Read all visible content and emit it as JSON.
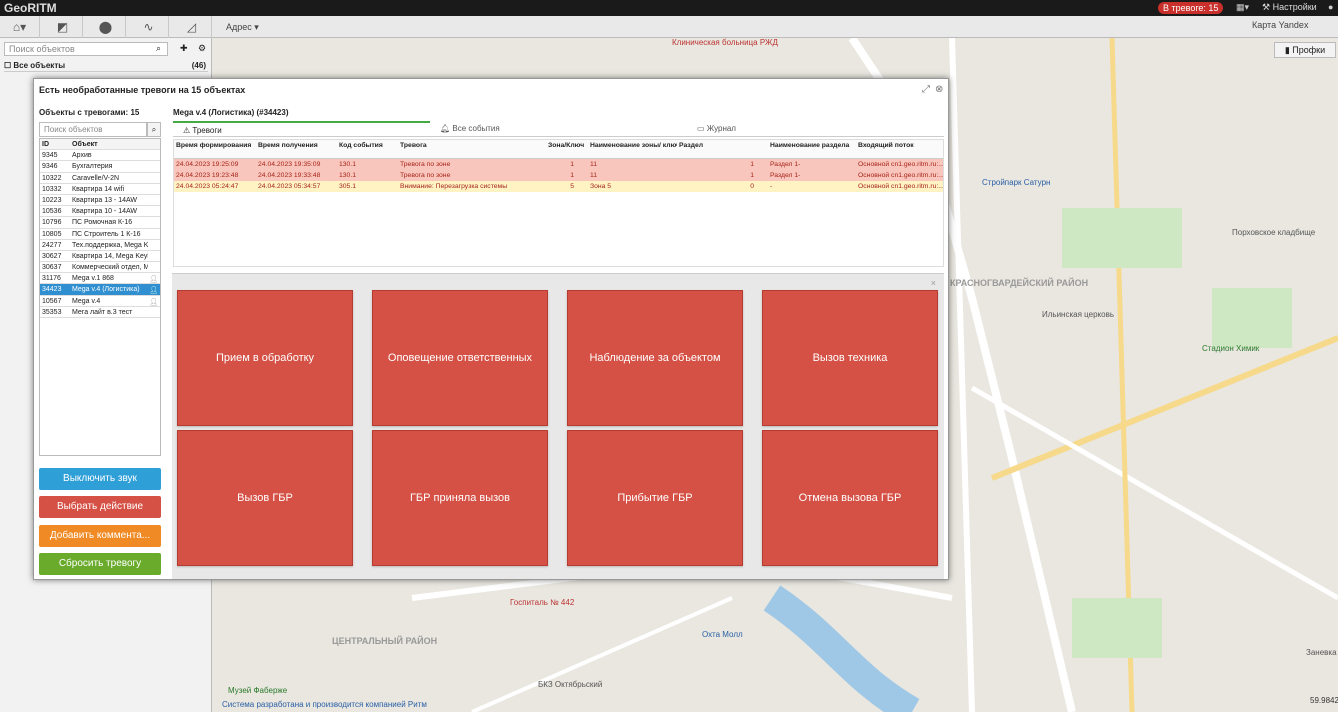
{
  "app": {
    "title": "GeoRITM",
    "alarms_badge": "В тревоге: 15",
    "settings_label": "Настройки"
  },
  "toolbar": {
    "address_label": "Адрес",
    "map_label": "Карта Yandex",
    "profiles_label": "Профки"
  },
  "left_panel": {
    "search_placeholder": "Поиск объектов",
    "all_objects_label": "Все объекты",
    "all_objects_count": "(46)"
  },
  "modal": {
    "title": "Есть необработанные тревоги на 15 объектах",
    "objects_with_alarms": "Объекты с тревогами: 15",
    "selected_object": "Mega v.4 (Логистика) (#34423)",
    "object_search_placeholder": "Поиск объектов",
    "object_columns": {
      "id": "ID",
      "name": "Объект"
    },
    "objects": [
      {
        "id": "9345",
        "name": "Архив"
      },
      {
        "id": "9346",
        "name": "Бухгалтерия"
      },
      {
        "id": "10322",
        "name": "Caravelle/V-2N"
      },
      {
        "id": "10332",
        "name": "Квартира 14 wifi"
      },
      {
        "id": "10223",
        "name": "Квартира 13 - 14AW"
      },
      {
        "id": "10536",
        "name": "Квартира 10 - 14AW"
      },
      {
        "id": "10796",
        "name": "ПС Ромочная К-16"
      },
      {
        "id": "10805",
        "name": "ПС Строитель 1 К-16"
      },
      {
        "id": "24277",
        "name": "Тех.поддержка, Mega Keyb..."
      },
      {
        "id": "30627",
        "name": "Квартира 14, Mega Keybo..."
      },
      {
        "id": "30637",
        "name": "Коммерческий отдел, Meg..."
      },
      {
        "id": "31176",
        "name": "Mega v.1 868"
      },
      {
        "id": "34423",
        "name": "Mega v.4 (Логистика)"
      },
      {
        "id": "10567",
        "name": "Mega v.4"
      },
      {
        "id": "35353",
        "name": "Мега лайт в.3 тест"
      }
    ],
    "buttons": {
      "mute": "Выключить звук",
      "choose_action": "Выбрать действие",
      "add_comment": "Добавить коммента...",
      "reset_alarm": "Сбросить тревогу"
    },
    "tabs": {
      "alarms": "Тревоги",
      "all_events": "Все события",
      "journal": "Журнал"
    },
    "columns": [
      "Время формирования",
      "Время получения",
      "Код события",
      "Тревога",
      "Зона/Ключ",
      "Наименование зоны/ ключа",
      "Раздел",
      "Наименование раздела",
      "Входящий поток"
    ],
    "rows": [
      {
        "formed": "24.04.2023 19:25:09",
        "received": "24.04.2023 19:35:09",
        "code": "130.1",
        "alarm": "Тревога по зоне",
        "zone": "1",
        "zone_name": "11",
        "section": "1",
        "section_name": "Раздел 1-",
        "stream": "Основной cn1.geo.ritm.ru:..."
      },
      {
        "formed": "24.04.2023 19:23:48",
        "received": "24.04.2023 19:33:48",
        "code": "130.1",
        "alarm": "Тревога по зоне",
        "zone": "1",
        "zone_name": "11",
        "section": "1",
        "section_name": "Раздел 1-",
        "stream": "Основной cn1.geo.ritm.ru:..."
      },
      {
        "formed": "24.04.2023 05:24:47",
        "received": "24.04.2023 05:34:57",
        "code": "305.1",
        "alarm": "Внимание: Перезагрузка системы",
        "zone": "5",
        "zone_name": "Зона 5",
        "section": "0",
        "section_name": "-",
        "stream": "Основной cn1.geo.ritm.ru:..."
      }
    ],
    "actions": [
      "Прием в обработку",
      "Оповещение ответственных",
      "Наблюдение за объектом",
      "Вызов техника",
      "Вызов ГБР",
      "ГБР приняла вызов",
      "Прибытие ГБР",
      "Отмена вызова ГБР"
    ]
  },
  "map": {
    "labels": [
      "Клиническая больница РЖД",
      "Стройпарк Сатурн",
      "Порховское кладбище",
      "КРАСНОГВАРДЕЙСКИЙ РАЙОН",
      "Ильинская церковь",
      "Стадион Химик",
      "ЦЕНТРАЛЬНЫЙ РАЙОН",
      "Госпиталь № 442",
      "БКЗ Октябрьский",
      "Охта Молл",
      "Музей Фаберже",
      "Заневка"
    ],
    "credit": "Система разработана и производится компанией Ритм",
    "coords": "59.9842"
  },
  "colors": {
    "alarm_red": "#d55045",
    "mute_blue": "#2f9fd8",
    "comment_orange": "#f08a24",
    "reset_green": "#6aab2c"
  }
}
